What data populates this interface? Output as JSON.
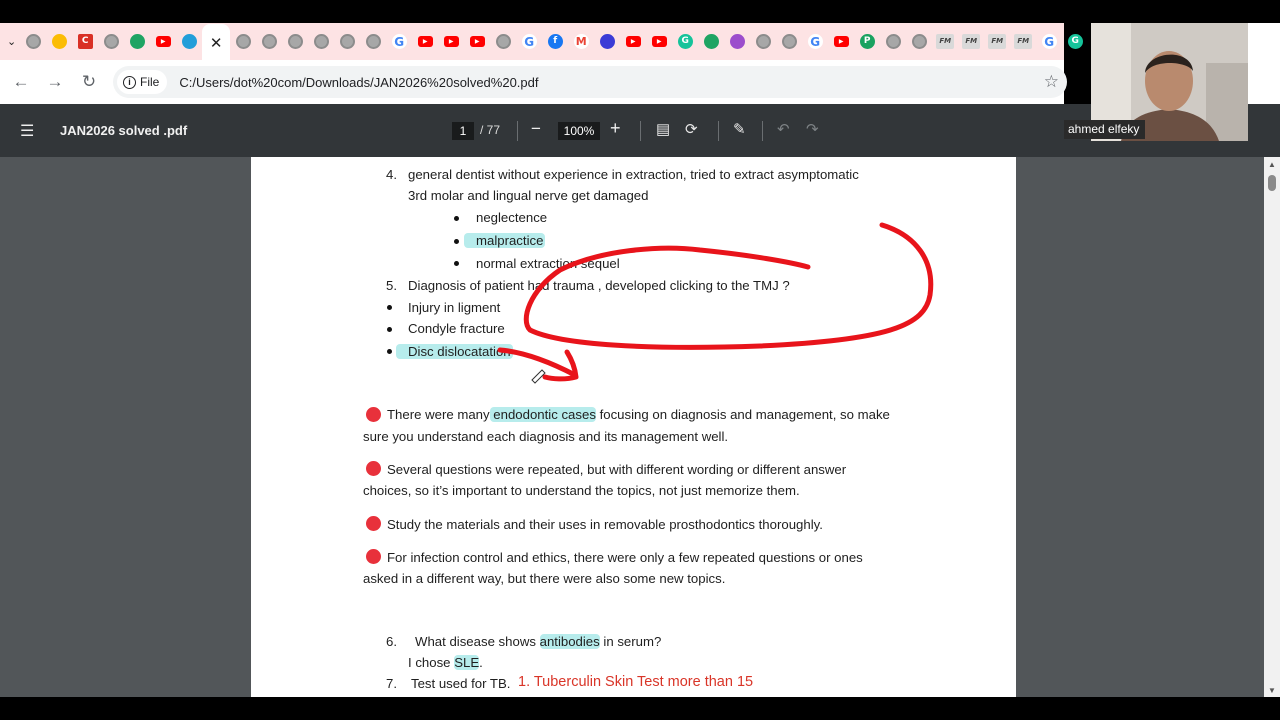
{
  "browser": {
    "url": "C:/Users/dot%20com/Downloads/JAN2026%20solved%20.pdf",
    "site_chip": "File",
    "tabs": [
      {
        "icon": "generic-favicon-icon",
        "color": "#a7a7a7"
      },
      {
        "icon": "google-ads-icon",
        "color": "#fbbc04"
      },
      {
        "icon": "c-app-icon",
        "color": "#d93025",
        "glyph": "C"
      },
      {
        "icon": "generic-favicon-icon",
        "color": "#a7a7a7"
      },
      {
        "icon": "google-drive-icon",
        "color": "#1fa463"
      },
      {
        "icon": "youtube-icon",
        "color": "#ff0000"
      },
      {
        "icon": "telegram-icon",
        "color": "#229ed9"
      },
      {
        "icon": "active-tab",
        "color": "#ffffff"
      },
      {
        "icon": "generic-favicon-icon",
        "color": "#a7a7a7"
      },
      {
        "icon": "generic-favicon-icon",
        "color": "#a7a7a7"
      },
      {
        "icon": "generic-favicon-icon",
        "color": "#a7a7a7"
      },
      {
        "icon": "generic-favicon-icon",
        "color": "#a7a7a7"
      },
      {
        "icon": "generic-favicon-icon",
        "color": "#a7a7a7"
      },
      {
        "icon": "generic-favicon-icon",
        "color": "#a7a7a7"
      },
      {
        "icon": "google-icon",
        "color": "#4285f4",
        "glyph": "G"
      },
      {
        "icon": "youtube-icon",
        "color": "#ff0000"
      },
      {
        "icon": "youtube-icon",
        "color": "#ff0000"
      },
      {
        "icon": "youtube-icon",
        "color": "#ff0000"
      },
      {
        "icon": "generic-favicon-icon",
        "color": "#a7a7a7"
      },
      {
        "icon": "google-icon",
        "color": "#4285f4",
        "glyph": "G"
      },
      {
        "icon": "facebook-icon",
        "color": "#1877f2",
        "glyph": "f"
      },
      {
        "icon": "gmail-icon",
        "color": "#ea4335",
        "glyph": "M"
      },
      {
        "icon": "app-icon",
        "color": "#3b3bd6"
      },
      {
        "icon": "youtube-icon",
        "color": "#ff0000"
      },
      {
        "icon": "youtube-icon",
        "color": "#ff0000"
      },
      {
        "icon": "grammarly-icon",
        "color": "#15c39a",
        "glyph": "G"
      },
      {
        "icon": "google-drive-icon",
        "color": "#1fa463"
      },
      {
        "icon": "app-icon",
        "color": "#9c4dcc"
      },
      {
        "icon": "generic-favicon-icon",
        "color": "#d0d0d0"
      },
      {
        "icon": "generic-favicon-icon",
        "color": "#a7a7a7"
      },
      {
        "icon": "google-icon",
        "color": "#4285f4",
        "glyph": "G"
      },
      {
        "icon": "youtube-icon",
        "color": "#ff0000"
      },
      {
        "icon": "p-app-icon",
        "color": "#1aa260",
        "glyph": "P"
      },
      {
        "icon": "generic-favicon-icon",
        "color": "#f3c1c1"
      },
      {
        "icon": "generic-favicon-icon",
        "color": "#a7a7a7"
      },
      {
        "icon": "fm-icon",
        "color": "#d9d9d9",
        "glyph": "FM"
      },
      {
        "icon": "fm-icon",
        "color": "#d9d9d9",
        "glyph": "FM"
      },
      {
        "icon": "fm-icon",
        "color": "#d9d9d9",
        "glyph": "FM"
      },
      {
        "icon": "fm-icon",
        "color": "#d9d9d9",
        "glyph": "FM"
      },
      {
        "icon": "google-icon",
        "color": "#4285f4",
        "glyph": "G"
      },
      {
        "icon": "grammarly-icon",
        "color": "#15c39a",
        "glyph": "G"
      }
    ]
  },
  "pdf_viewer": {
    "title": "JAN2026 solved .pdf",
    "current_page": "1",
    "total_pages": "/ 77",
    "zoom": "100%"
  },
  "document": {
    "q4_num": "4.",
    "q4_line1": "general dentist without experience in extraction, tried to extract asymptomatic",
    "q4_line2": "3rd molar and lingual nerve get damaged",
    "q4_opt1": "neglectence",
    "q4_opt2": "malpractice",
    "q4_opt3": "normal extraction sequel",
    "q5_num": "5.",
    "q5_text": "Diagnosis of patient had trauma , developed clicking to the TMJ ?",
    "q5_opt1": "Injury in ligment",
    "q5_opt2": "Condyle fracture",
    "q5_opt3": "Disc dislocatation",
    "note1_a": "There were many",
    "note1_hl": " endodontic cases",
    "note1_b": " focusing on diagnosis and management, so make",
    "note1_line2": "sure you understand each diagnosis and its management well.",
    "note2_line1": "Several questions were repeated, but with different wording or different answer",
    "note2_line2": "choices, so it’s important to understand the topics, not just memorize them.",
    "note3": "Study the materials and their uses in removable prosthodontics thoroughly.",
    "note4_line1": "For infection control and ethics, there were only a few repeated questions or ones",
    "note4_line2": "asked in a different way, but there were also some new topics.",
    "q6_num": "6.",
    "q6_a": "What disease shows ",
    "q6_hl": "antibodies",
    "q6_b": " in serum?",
    "q6_answer_a": "I chose ",
    "q6_answer_hl": "SLE",
    "q6_answer_b": ".",
    "q7_num": "7.",
    "q7_text": "Test used for TB.",
    "q7_answer": "1. Tuberculin Skin Test more than 15"
  },
  "webcam": {
    "name": "ahmed elfeky"
  },
  "colors": {
    "highlight": "#b7ecec",
    "annotation_red": "#e8141b",
    "bullet_red": "#e8313b",
    "answer_red": "#d93528"
  }
}
